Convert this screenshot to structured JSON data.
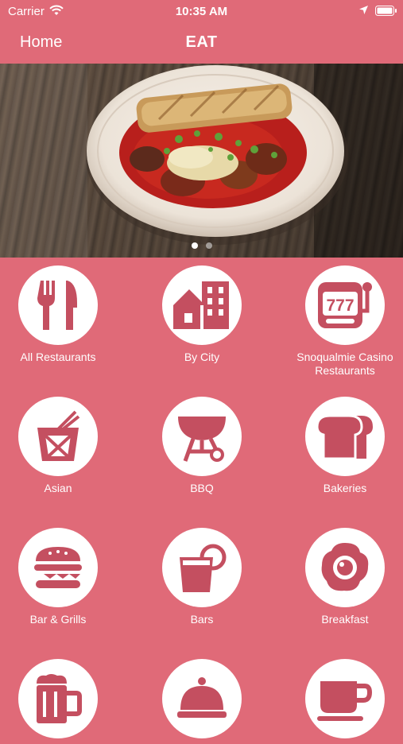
{
  "status_bar": {
    "carrier": "Carrier",
    "time": "10:35 AM"
  },
  "nav": {
    "back_label": "Home",
    "title": "EAT"
  },
  "carousel": {
    "page_count": 2,
    "current_page": 1
  },
  "colors": {
    "background": "#e06a78",
    "icon": "#c44f60",
    "text": "#ffffff"
  },
  "categories": [
    {
      "label": "All Restaurants",
      "icon": "fork-knife-icon"
    },
    {
      "label": "By City",
      "icon": "city-icon"
    },
    {
      "label": "Snoqualmie Casino Restaurants",
      "icon": "slot-machine-icon"
    },
    {
      "label": "Asian",
      "icon": "takeout-box-icon"
    },
    {
      "label": "BBQ",
      "icon": "grill-icon"
    },
    {
      "label": "Bakeries",
      "icon": "bread-icon"
    },
    {
      "label": "Bar & Grills",
      "icon": "burger-icon"
    },
    {
      "label": "Bars",
      "icon": "drink-glass-icon"
    },
    {
      "label": "Breakfast",
      "icon": "egg-icon"
    },
    {
      "label": "",
      "icon": "beer-mug-icon"
    },
    {
      "label": "",
      "icon": "cloche-icon"
    },
    {
      "label": "",
      "icon": "coffee-cup-icon"
    }
  ]
}
